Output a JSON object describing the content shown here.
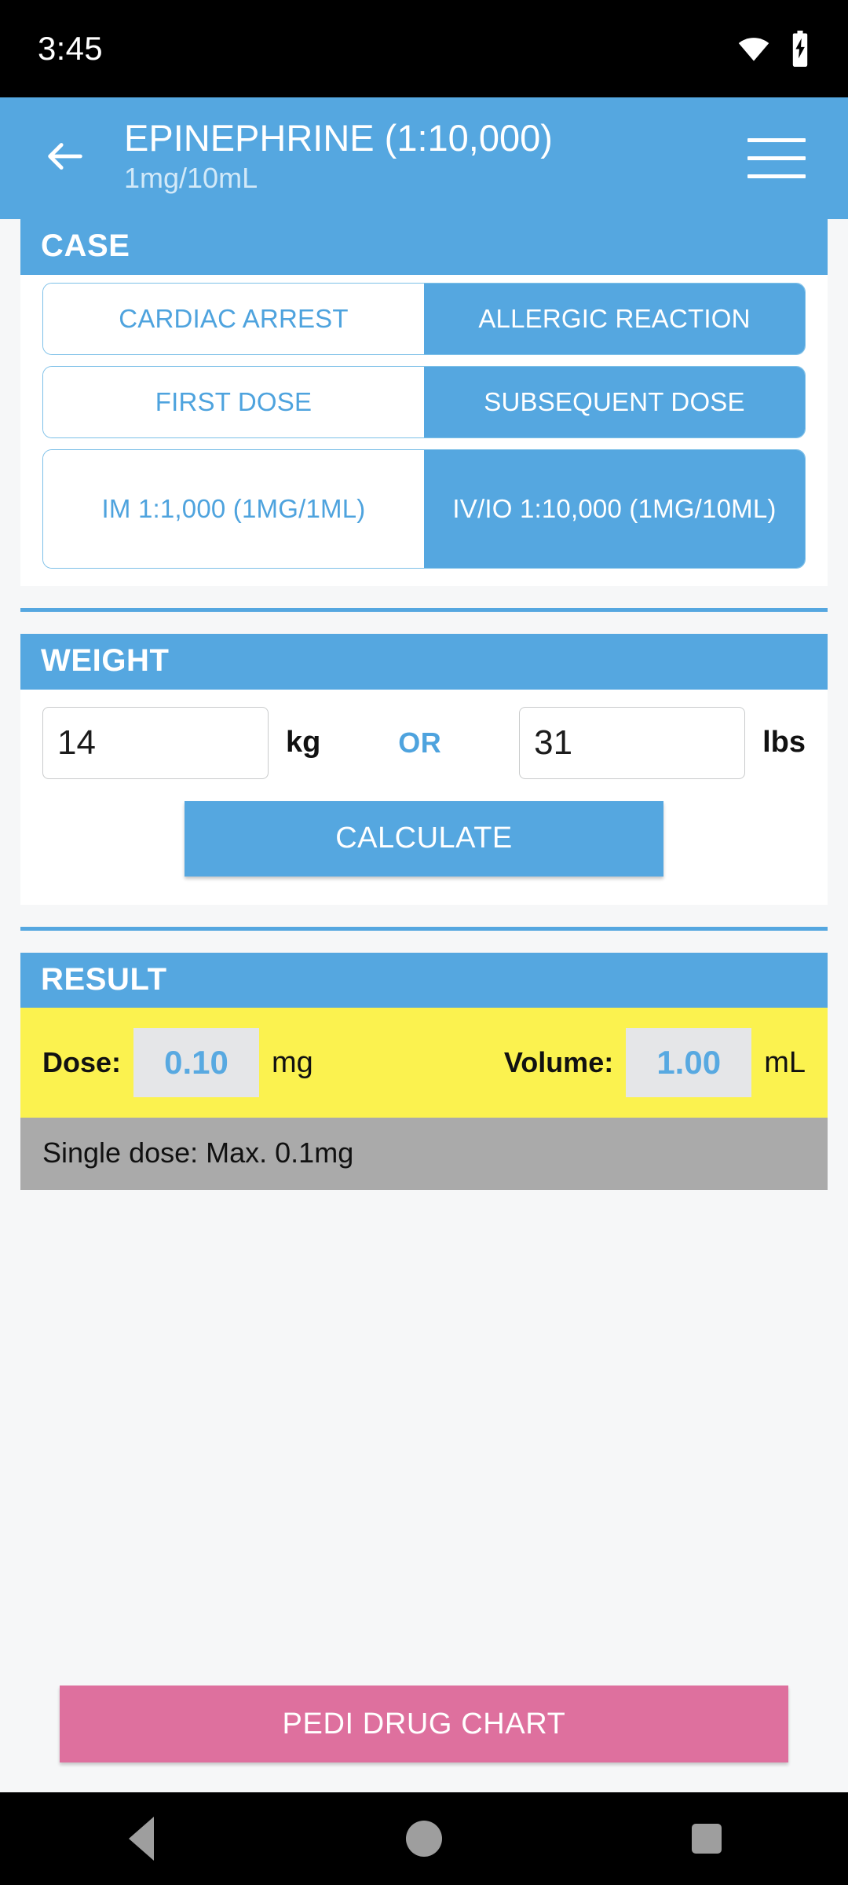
{
  "status_bar": {
    "clock": "3:45",
    "wifi_icon": "wifi-icon",
    "battery_icon": "battery-charging-icon"
  },
  "app_bar": {
    "back_icon": "back-arrow-icon",
    "title": "EPINEPHRINE (1:10,000)",
    "subtitle": "1mg/10mL",
    "menu_icon": "hamburger-menu-icon"
  },
  "colors": {
    "primary_blue": "#55a7e0",
    "page_background": "#f6f7f8",
    "result_yellow": "#fbf24f",
    "result_grey": "#aaaaaa",
    "pedi_pink": "#de709e",
    "value_blue": "#58a9e1"
  },
  "case_section": {
    "header": "CASE",
    "rows": [
      {
        "name": "case-type",
        "options": [
          {
            "label": "CARDIAC ARREST",
            "selected": false
          },
          {
            "label": "ALLERGIC REACTION",
            "selected": true
          }
        ]
      },
      {
        "name": "dose-order",
        "options": [
          {
            "label": "FIRST DOSE",
            "selected": false
          },
          {
            "label": "SUBSEQUENT DOSE",
            "selected": true
          }
        ]
      },
      {
        "name": "route-concentration",
        "options": [
          {
            "label": "IM 1:1,000 (1MG/1ML)",
            "selected": false
          },
          {
            "label": "IV/IO 1:10,000 (1MG/10ML)",
            "selected": true
          }
        ]
      }
    ]
  },
  "weight_section": {
    "header": "WEIGHT",
    "kg_value": "14",
    "kg_placeholder": "kg",
    "kg_unit": "kg",
    "or_label": "OR",
    "lbs_value": "31",
    "lbs_placeholder": "lbs",
    "lbs_unit": "lbs",
    "calculate_label": "CALCULATE"
  },
  "result_section": {
    "header": "RESULT",
    "dose_label": "Dose:",
    "dose_value": "0.10",
    "dose_unit": "mg",
    "volume_label": "Volume:",
    "volume_value": "1.00",
    "volume_unit": "mL",
    "note": "Single dose: Max. 0.1mg"
  },
  "footer": {
    "pedi_chart_label": "PEDI DRUG CHART"
  },
  "nav_bar": {
    "back_icon": "nav-back-triangle-icon",
    "home_icon": "nav-home-circle-icon",
    "recents_icon": "nav-recents-square-icon"
  }
}
